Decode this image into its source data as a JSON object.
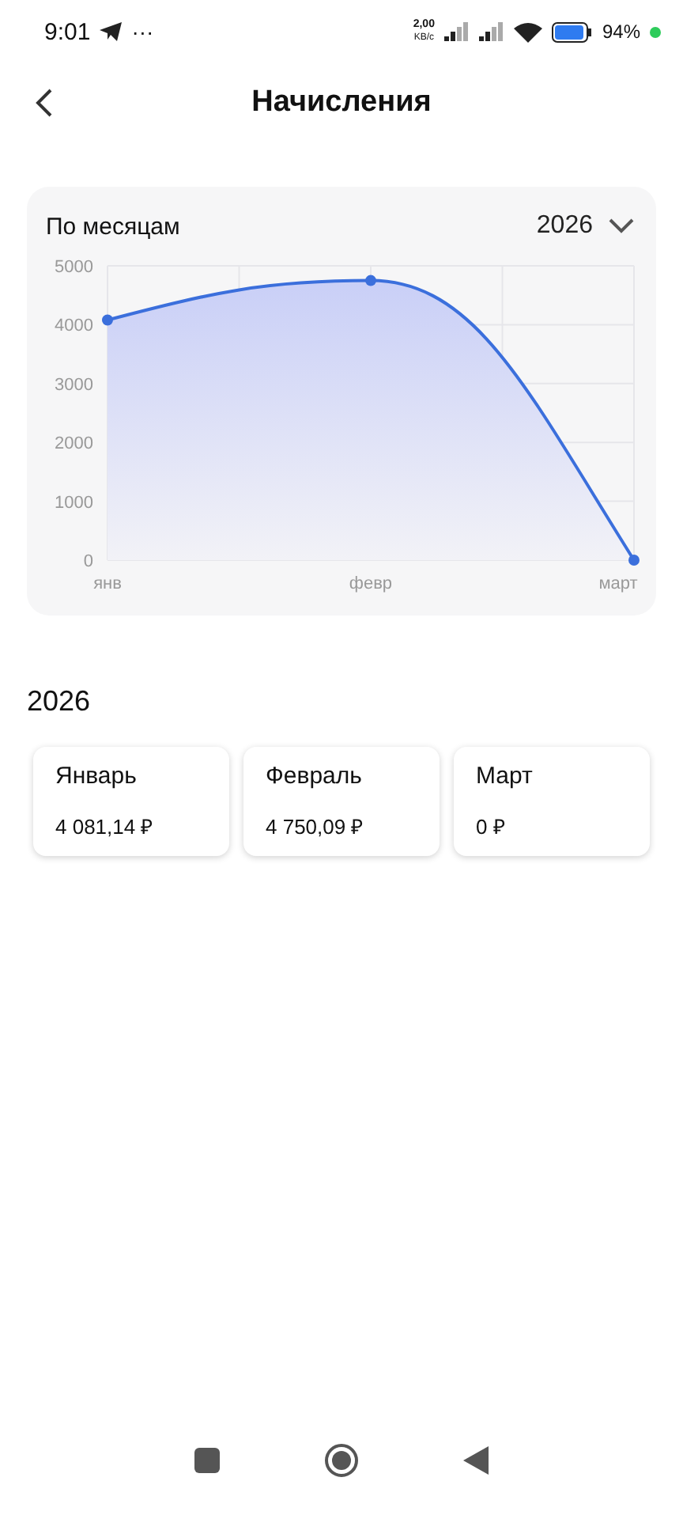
{
  "status_bar": {
    "time": "9:01",
    "more": "···",
    "speed_value": "2,00",
    "speed_unit": "KB/c",
    "battery_text": "94%"
  },
  "header": {
    "title": "Начисления"
  },
  "chart_card": {
    "title": "По месяцам",
    "year": "2026",
    "chart_data": {
      "type": "area",
      "categories": [
        "янв",
        "февр",
        "март"
      ],
      "series": [
        {
          "color": "#3b6fdc",
          "values": [
            4080,
            4750,
            0
          ]
        }
      ],
      "grid": true,
      "ylim": [
        0,
        5000
      ],
      "yticks": [
        0,
        1000,
        2000,
        3000,
        4000,
        5000
      ]
    }
  },
  "section": {
    "title": "2026"
  },
  "months": [
    {
      "name": "Январь",
      "amount": "4 081,14 ₽"
    },
    {
      "name": "Февраль",
      "amount": "4 750,09 ₽"
    },
    {
      "name": "Март",
      "amount": "0 ₽"
    }
  ]
}
